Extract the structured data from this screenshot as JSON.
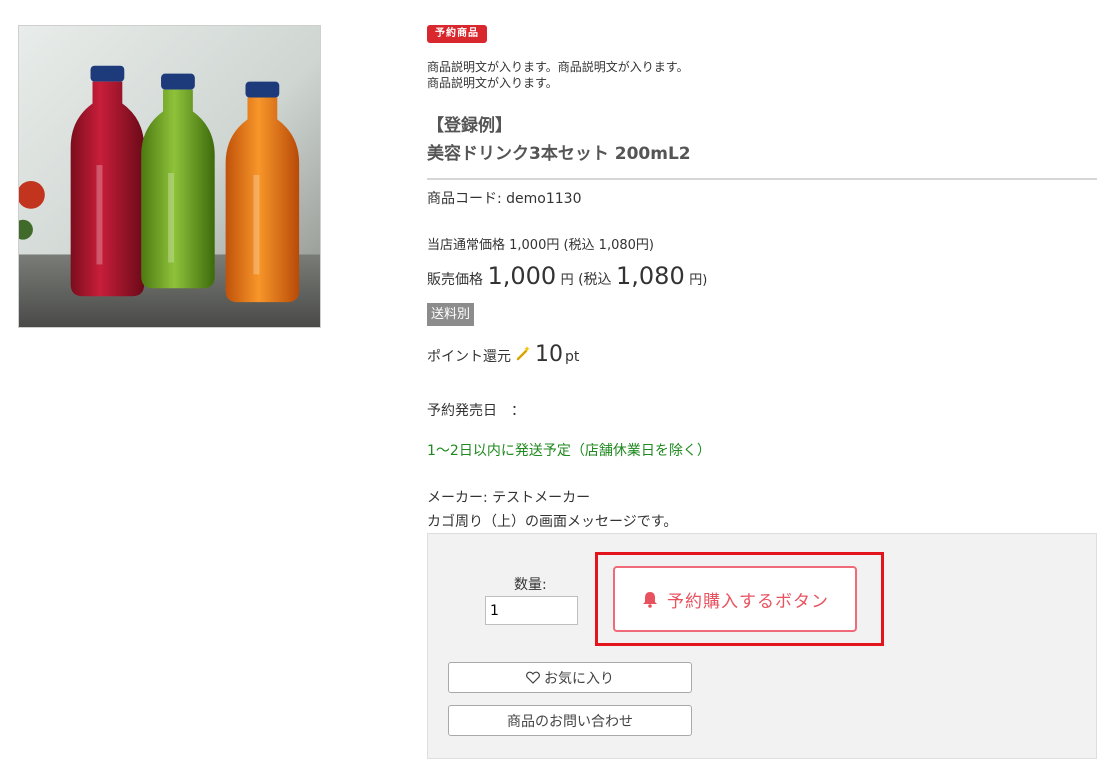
{
  "product": {
    "badge": "予約商品",
    "description_line1": "商品説明文が入ります。商品説明文が入ります。",
    "description_line2": "商品説明文が入ります。",
    "title_line1": "【登録例】",
    "title_line2": "美容ドリンク3本セット 200mL2",
    "code": "商品コード: demo1130",
    "regular_price": "当店通常価格 1,000円 (税込 1,080円)",
    "price_label": "販売価格",
    "price": "1,000",
    "price_unit": "円",
    "tax_label": "(税込",
    "tax_price": "1,080",
    "tax_unit": "円)",
    "shipping": "送料別",
    "point_label": "ポイント還元",
    "point_value": "10",
    "point_unit": "pt",
    "release_date": "予約発売日　：",
    "shipping_schedule": "1～2日以内に発送予定（店舗休業日を除く）",
    "maker": "メーカー: テストメーカー",
    "cart_message": "カゴ周り（上）の画面メッセージです。"
  },
  "cart": {
    "qty_label": "数量:",
    "qty_value": "1",
    "reserve_button": "予約購入するボタン",
    "favorite_button": "お気に入り",
    "inquiry_button": "商品のお問い合わせ"
  },
  "colors": {
    "badge": "#d9272e",
    "reserve_accent": "#e8525f",
    "highlight": "#e3141c",
    "schedule_text": "#1f8a1f"
  }
}
